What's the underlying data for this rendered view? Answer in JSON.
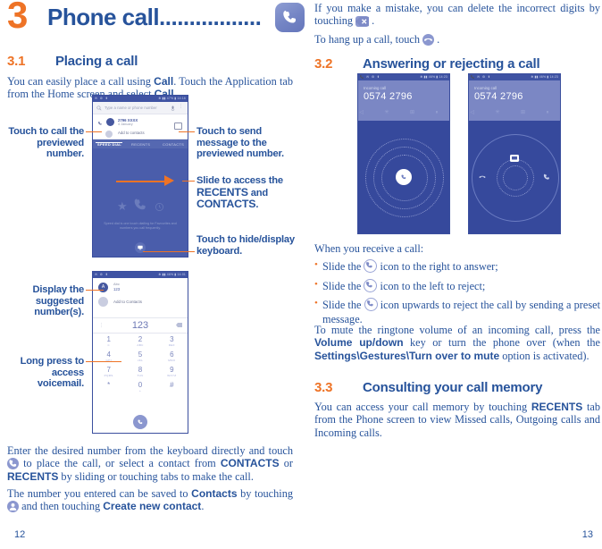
{
  "chapter": {
    "number": "3",
    "title": "Phone call.................",
    "icon": "phone-handset-icon"
  },
  "left_column": {
    "section": {
      "number": "3.1",
      "title": "Placing a call"
    },
    "intro_parts": {
      "p1_a": "You can easily place a call using ",
      "p1_b1": "Call",
      "p1_c": ". Touch the Application tab from the Home screen and select ",
      "p1_b2": "Call",
      "p1_d": "."
    },
    "annotations": [
      {
        "id": "touch-to-call",
        "text": "Touch to call the previewed number."
      },
      {
        "id": "touch-to-send-message",
        "text": "Touch to send message to the previewed number."
      },
      {
        "id": "slide-to-access",
        "text_a": "Slide to access the ",
        "text_b1": "RECENTS",
        "text_c": " and ",
        "text_b2": "CONTACTS",
        "text_d": "."
      },
      {
        "id": "touch-to-hide-keyboard",
        "text": "Touch to hide/display keyboard."
      },
      {
        "id": "display-suggested-number",
        "text": "Display the suggested number(s)."
      },
      {
        "id": "long-press-voicemail",
        "text": "Long press to access voicemail."
      }
    ],
    "closing_parts": {
      "p2_a": "Enter the desired number from the keyboard directly and touch ",
      "p2_icon": "call-button-icon",
      "p2_b": " to place the call, or select a contact from ",
      "p2_bold1": "CONTACTS",
      "p2_c": " or ",
      "p2_bold2": "RECENTS",
      "p2_d": " by sliding or touching tabs to make the call.",
      "p3_a": "The number you entered can be saved to ",
      "p3_bold1": "Contacts",
      "p3_b": " by touching ",
      "p3_icon": "add-contact-icon",
      "p3_c": " and then touching ",
      "p3_bold2": "Create new contact",
      "p3_d": "."
    },
    "page_number": "12"
  },
  "right_column": {
    "top_parts": {
      "p1_a": "If you make a mistake, you can delete the incorrect digits by touching ",
      "p1_icon": "backspace-delete-icon",
      "p1_b": " .",
      "p2_a": "To hang up a call, touch ",
      "p2_icon": "end-call-icon",
      "p2_b": " ."
    },
    "section_32": {
      "number": "3.2",
      "title": "Answering or rejecting a call"
    },
    "receive_intro": "When you receive a call:",
    "bullets": [
      {
        "a": "Slide the ",
        "icon": "answer-call-icon",
        "b": " icon to the right to answer;"
      },
      {
        "a": "Slide the ",
        "icon": "reject-call-icon",
        "b": " icon to the left to reject;"
      },
      {
        "a": "Slide the ",
        "icon": "preset-message-icon",
        "b": " icon upwards to reject the call by sending a preset message."
      }
    ],
    "mute_parts": {
      "a": "To mute the ringtone volume of an incoming call, press the ",
      "bold1": "Volume up/down",
      "b": " key or turn the phone over (when the ",
      "bold2": "Settings\\Gestures\\Turn over to mute",
      "c": " option is activated)."
    },
    "section_33": {
      "number": "3.3",
      "title": "Consulting your call memory"
    },
    "memory_parts": {
      "a": "You can access your call memory by touching ",
      "bold1": "RECENTS",
      "b": " tab from the Phone screen to view Missed calls, Outgoing calls and Incoming calls."
    },
    "page_number": "13"
  },
  "phone_mockup_1": {
    "status_left": "✉ ⚙ ⬆",
    "status_right": "✻ ▮▮ 47% ▮ 14:16",
    "search_placeholder": "Type a name or phone number",
    "contact_name": "2796 XXXX",
    "contact_date": "4 January",
    "add_to_contacts": "Add to contacts",
    "tabs": [
      "SPEED DIAL",
      "RECENTS",
      "CONTACTS"
    ],
    "hint": "Speed dial is one touch dialling for Favourites and numbers you call frequently."
  },
  "phone_mockup_2": {
    "status_left": "✉ ⚙ ⬆",
    "status_right": "✻ ▮▮ 46% ▮ 14:01",
    "suggestion_label": "Abc",
    "suggestion_number": "123",
    "add_to_contacts": "Add to Contacts",
    "dialed_number": "123",
    "keys": [
      {
        "digit": "1",
        "sub": "∞"
      },
      {
        "digit": "2",
        "sub": "ABC"
      },
      {
        "digit": "3",
        "sub": "DEF"
      },
      {
        "digit": "4",
        "sub": "GHI"
      },
      {
        "digit": "5",
        "sub": "JKL"
      },
      {
        "digit": "6",
        "sub": "MNO"
      },
      {
        "digit": "7",
        "sub": "PQRS"
      },
      {
        "digit": "8",
        "sub": "TUV"
      },
      {
        "digit": "9",
        "sub": "WXYZ"
      },
      {
        "digit": "*",
        "sub": ""
      },
      {
        "digit": "0",
        "sub": "+"
      },
      {
        "digit": "#",
        "sub": ""
      }
    ]
  },
  "phone_mockup_3": {
    "status_left": "📞 ✉ ⚙ ⬆",
    "status_right": "✻ ▮▮ 46% ▮ 14:23",
    "call_label": "Incoming call",
    "call_number": "0574 2796"
  },
  "phone_mockup_4": {
    "status_left": "📞 ✉ ⚙ ⬆",
    "status_right": "✻ ▮▮ 46% ▮ 14:23",
    "call_label": "Incoming call",
    "call_number": "0574 2796"
  },
  "colors": {
    "accent_orange": "#ee7326",
    "text_blue": "#27539b",
    "phone_blue": "#4054a4",
    "icon_purple": "#8b97cf"
  }
}
